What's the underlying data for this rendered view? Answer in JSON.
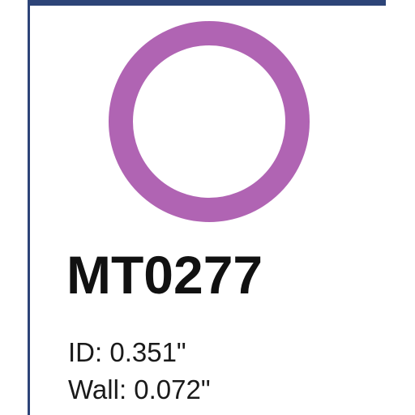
{
  "product": {
    "part_number": "MT0277",
    "ring_color": "#b064b3",
    "specs": [
      {
        "label": "ID:",
        "value": "0.351\""
      },
      {
        "label": "Wall:",
        "value": "0.072\""
      }
    ]
  },
  "theme": {
    "border_color": "#2d4478"
  }
}
